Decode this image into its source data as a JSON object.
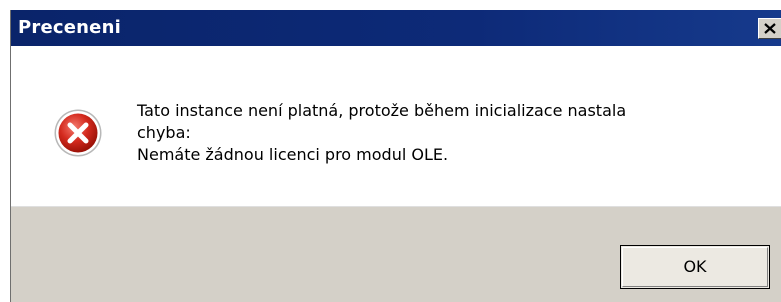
{
  "dialog": {
    "title": "Preceneni",
    "close_icon": "close-icon",
    "icon": "error-icon",
    "message_lines": [
      "Tato instance není platná, protože během inicializace nastala",
      "chyba:",
      "Nemáte žádnou licenci pro modul OLE."
    ],
    "ok_label": "OK"
  },
  "colors": {
    "titlebar": "#0a246a",
    "footer": "#d4d0c8",
    "error_red": "#d32f2f"
  }
}
